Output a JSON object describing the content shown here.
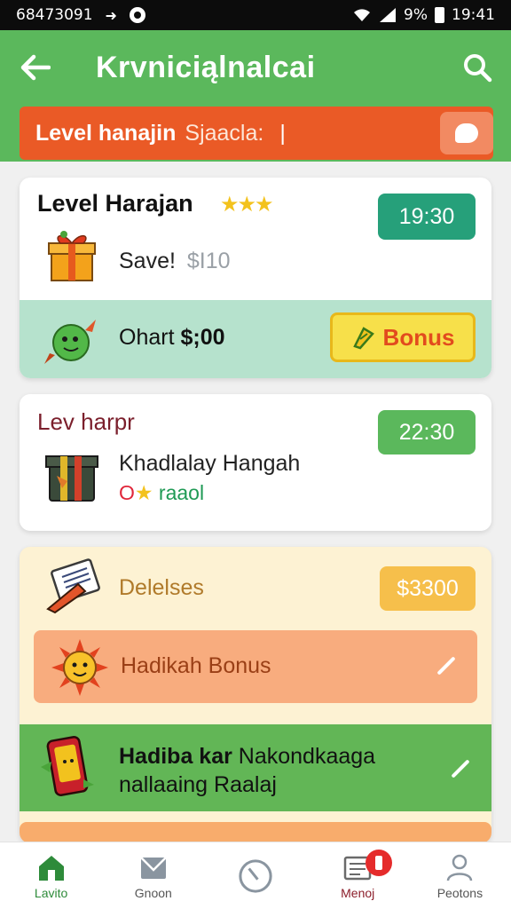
{
  "status_bar": {
    "carrier": "68473091",
    "battery_pct": "9%",
    "time": "19:41"
  },
  "app_bar": {
    "title": "Krvniciąlnalcai"
  },
  "banner": {
    "label": "Level hanajin",
    "input_value": "Sjaacla:"
  },
  "card1": {
    "title": "Level Harajan",
    "stars": "★★★",
    "time": "19:30",
    "save_label": "Save!",
    "save_amount": "$I10",
    "sub_label": "Ohart",
    "sub_amount": "$;00",
    "bonus_label": "Bonus"
  },
  "card2": {
    "title": "Lev harpr",
    "time": "22:30",
    "name": "Khadlalay Hangah",
    "status_o": "O",
    "status_star": "★",
    "status_text": "raaol"
  },
  "card3": {
    "label": "Delelses",
    "price": "$3300",
    "row1_label": "Hadikah Bonus",
    "row2_bold": "Hadiba kar",
    "row2_rest": " Nakondkaaga",
    "row2_line2": "nallaaing Raalaj"
  },
  "bottom_nav": [
    {
      "label": "Lavito",
      "icon": "home-icon"
    },
    {
      "label": "Gnoon",
      "icon": "mail-icon"
    },
    {
      "label": "",
      "icon": "clock-icon"
    },
    {
      "label": "Menoj",
      "icon": "list-icon"
    },
    {
      "label": "Peotons",
      "icon": "person-icon"
    }
  ],
  "colors": {
    "app_bar": "#5bb85c",
    "banner": "#ea5a26",
    "accent_green": "#26a07a",
    "bonus_yellow": "#f7e04a",
    "mint": "#b6e2cd",
    "cream": "#fdf2d3",
    "peach": "#f8ac7e",
    "badge_red": "#e52b2b"
  }
}
